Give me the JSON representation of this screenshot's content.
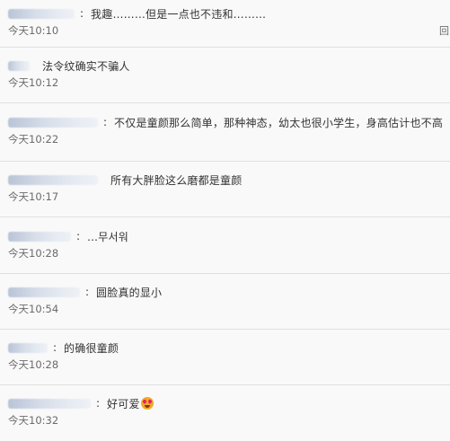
{
  "comments": [
    {
      "text": "我趣………但是一点也不违和………",
      "time": "今天10:10",
      "sep": ":"
    },
    {
      "text": "法令纹确实不骗人",
      "time": "今天10:12",
      "sep": ""
    },
    {
      "text": "不仅是童颜那么简单，那种神态，幼太也很小学生，身高估计也不高",
      "time": "今天10:22",
      "sep": ":"
    },
    {
      "text": "所有大胖脸这么磨都是童颜",
      "time": "今天10:17",
      "sep": ""
    },
    {
      "text": "…무서워",
      "time": "今天10:28",
      "sep": ":"
    },
    {
      "text": "圆脸真的显小",
      "time": "今天10:54",
      "sep": ":"
    },
    {
      "text": "的确很童颜",
      "time": "今天10:28",
      "sep": ":"
    },
    {
      "text": "好可爱",
      "time": "今天10:32",
      "sep": ":"
    }
  ],
  "reply_glyph": "回",
  "colors": {
    "background": "#f9f9f9",
    "divider": "#e0e0e0",
    "text": "#333333",
    "time": "#6b6b6b"
  },
  "icons": {
    "emoji": "heart-eyes-emoji-icon"
  }
}
